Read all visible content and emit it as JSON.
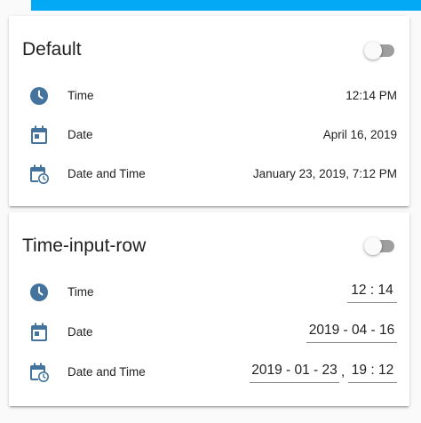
{
  "cards": [
    {
      "title": "Default",
      "toggle_on": false,
      "rows": [
        {
          "icon": "clock-icon",
          "label": "Time",
          "value": "12:14 PM"
        },
        {
          "icon": "calendar-icon",
          "label": "Date",
          "value": "April 16, 2019"
        },
        {
          "icon": "calendar-clock-icon",
          "label": "Date and Time",
          "value": "January 23, 2019, 7:12 PM"
        }
      ]
    },
    {
      "title": "Time-input-row",
      "toggle_on": false,
      "rows": [
        {
          "icon": "clock-icon",
          "label": "Time",
          "time": {
            "hour": "12",
            "sep": ":",
            "minute": "14"
          }
        },
        {
          "icon": "calendar-icon",
          "label": "Date",
          "date": {
            "year": "2019",
            "sep": "-",
            "month": "04",
            "day": "16"
          }
        },
        {
          "icon": "calendar-clock-icon",
          "label": "Date and Time",
          "date": {
            "year": "2019",
            "sep": "-",
            "month": "01",
            "day": "23"
          },
          "comma": ",",
          "time": {
            "hour": "19",
            "sep": ":",
            "minute": "12"
          }
        }
      ]
    }
  ],
  "colors": {
    "accent": "#03a9f4",
    "icon": "#44739e",
    "toggle_track": "#9e9e9e"
  }
}
